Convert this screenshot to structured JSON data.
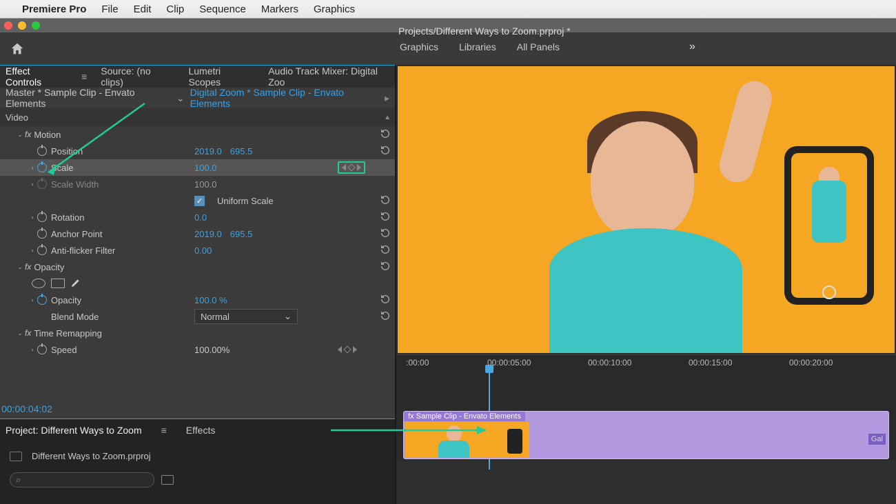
{
  "menubar": {
    "app": "Premiere Pro",
    "items": [
      "File",
      "Edit",
      "Clip",
      "Sequence",
      "Markers",
      "Graphics"
    ]
  },
  "project_path": "Projects/Different Ways to Zoom.prproj *",
  "workspace_tabs": [
    "Graphics",
    "Libraries",
    "All Panels"
  ],
  "panel_tabs": {
    "effect_controls": "Effect Controls",
    "source": "Source: (no clips)",
    "lumetri": "Lumetri Scopes",
    "audio_mixer": "Audio Track Mixer: Digital Zoo"
  },
  "ec_header": {
    "master": "Master * Sample Clip - Envato Elements",
    "seq": "Digital Zoom * Sample Clip - Envato Elements"
  },
  "video_label": "Video",
  "motion": {
    "label": "Motion",
    "position": {
      "label": "Position",
      "x": "2019.0",
      "y": "695.5"
    },
    "scale": {
      "label": "Scale",
      "v": "100.0"
    },
    "scale_width": {
      "label": "Scale Width",
      "v": "100.0"
    },
    "uniform": "Uniform Scale",
    "rotation": {
      "label": "Rotation",
      "v": "0.0"
    },
    "anchor": {
      "label": "Anchor Point",
      "x": "2019.0",
      "y": "695.5"
    },
    "flicker": {
      "label": "Anti-flicker Filter",
      "v": "0.00"
    }
  },
  "opacity": {
    "label": "Opacity",
    "prop": {
      "label": "Opacity",
      "v": "100.0 %"
    },
    "blend": {
      "label": "Blend Mode",
      "v": "Normal"
    }
  },
  "time_remap": {
    "label": "Time Remapping",
    "speed": {
      "label": "Speed",
      "v": "100.00%"
    }
  },
  "timecode": "00:00:04:02",
  "project_panel": {
    "title": "Project: Different Ways to Zoom",
    "effects": "Effects",
    "file": "Different Ways to Zoom.prproj"
  },
  "search_placeholder": "",
  "ruler": {
    "t0": ":00:00",
    "t1": "00:00:05:00",
    "t2": "00:00:10:00",
    "t3": "00:00:15:00",
    "t4": "00:00:20:00"
  },
  "clip": {
    "label": "fx  Sample Clip - Envato Elements",
    "badge": "Gal"
  }
}
